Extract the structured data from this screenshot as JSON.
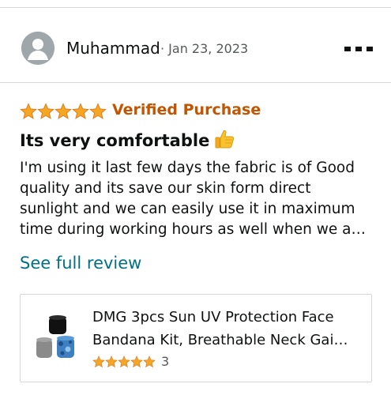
{
  "reviewer": {
    "name": "Muhammad",
    "date": "· Jan 23, 2023"
  },
  "review": {
    "rating": 5,
    "verified_label": "Verified Purchase",
    "title": "Its very comfortable",
    "title_emoji": "thumbs-up",
    "body_lines": [
      "I'm using it last few days the fabric is of Good",
      "quality and its save our skin form direct",
      "sunlight and we can easily use it in maximum",
      "time during working hours as well when we a…"
    ],
    "see_full_label": "See full review"
  },
  "product": {
    "title_lines": [
      "DMG 3pcs Sun UV Protection Face",
      "Bandana Kit, Breathable Neck Gai…"
    ],
    "rating": 5,
    "rating_count": "3"
  },
  "colors": {
    "star": "#f5a623",
    "verified": "#c45500",
    "link": "#007185"
  },
  "icons": {
    "avatar": "default-user-avatar-icon",
    "menu": "more-options-icon",
    "star": "star-icon",
    "thumb": "thumbs-up-icon"
  }
}
